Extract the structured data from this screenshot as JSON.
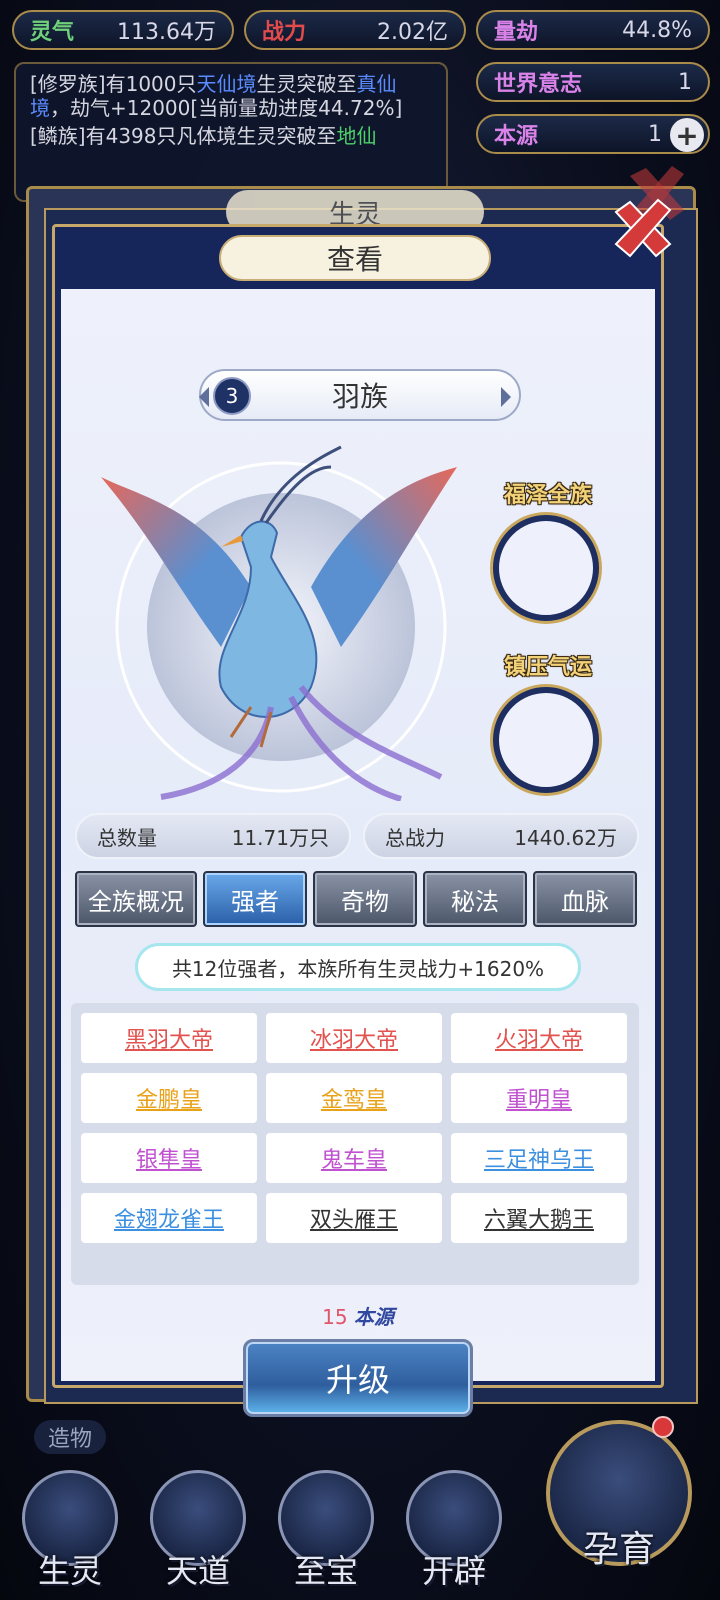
{
  "stats": {
    "lingqi": {
      "label": "灵气",
      "value": "113.64万"
    },
    "zhanli": {
      "label": "战力",
      "value": "2.02亿"
    },
    "liangjie": {
      "label": "量劫",
      "value": "44.8%"
    },
    "shijie": {
      "label": "世界意志",
      "value": "1"
    },
    "benyuan": {
      "label": "本源",
      "value": "1",
      "plus": "+"
    }
  },
  "log": {
    "line1": {
      "race": "[修罗族]",
      "text1": "有1000只",
      "realm": "天仙境",
      "text2": "生灵突破至",
      "target": "真仙境",
      "text3": "，劫气+12000[当前量劫进度44.72%]"
    },
    "line2": {
      "race": "[鳞族]",
      "text1": "有4398只凡体境生灵突破至",
      "target": "地仙"
    }
  },
  "background_tab": "生灵",
  "dialog": {
    "title": "查看",
    "race": {
      "level": "3",
      "name": "羽族"
    },
    "slots": [
      {
        "label": "福泽全族"
      },
      {
        "label": "镇压气运"
      }
    ],
    "totals": {
      "count_label": "总数量",
      "count_value": "11.71万只",
      "power_label": "总战力",
      "power_value": "1440.62万"
    },
    "tabs": [
      "全族概况",
      "强者",
      "奇物",
      "秘法",
      "血脉"
    ],
    "active_tab": 1,
    "summary": "共12位强者，本族所有生灵战力+1620%",
    "strong": [
      {
        "name": "黑羽大帝",
        "color": "#e2524f"
      },
      {
        "name": "冰羽大帝",
        "color": "#e2524f"
      },
      {
        "name": "火羽大帝",
        "color": "#e2524f"
      },
      {
        "name": "金鹏皇",
        "color": "#e8a21a"
      },
      {
        "name": "金鸾皇",
        "color": "#e8a21a"
      },
      {
        "name": "重明皇",
        "color": "#c052d0"
      },
      {
        "name": "银隼皇",
        "color": "#c052d0"
      },
      {
        "name": "鬼车皇",
        "color": "#c052d0"
      },
      {
        "name": "三足神乌王",
        "color": "#3d8fe0"
      },
      {
        "name": "金翅龙雀王",
        "color": "#3d8fe0"
      },
      {
        "name": "双头雁王",
        "color": "#333333"
      },
      {
        "name": "六翼大鹅王",
        "color": "#333333"
      }
    ],
    "cost": {
      "amount": "15",
      "label": "本源"
    },
    "upgrade_label": "升级"
  },
  "side_label": "造物",
  "nav": {
    "shengling": "生灵",
    "tiandao": "天道",
    "zhibao": "至宝",
    "kaipi": "开辟",
    "yunyu": "孕育"
  },
  "icons": {
    "close": "close-icon",
    "phoenix": "phoenix-illustration"
  }
}
